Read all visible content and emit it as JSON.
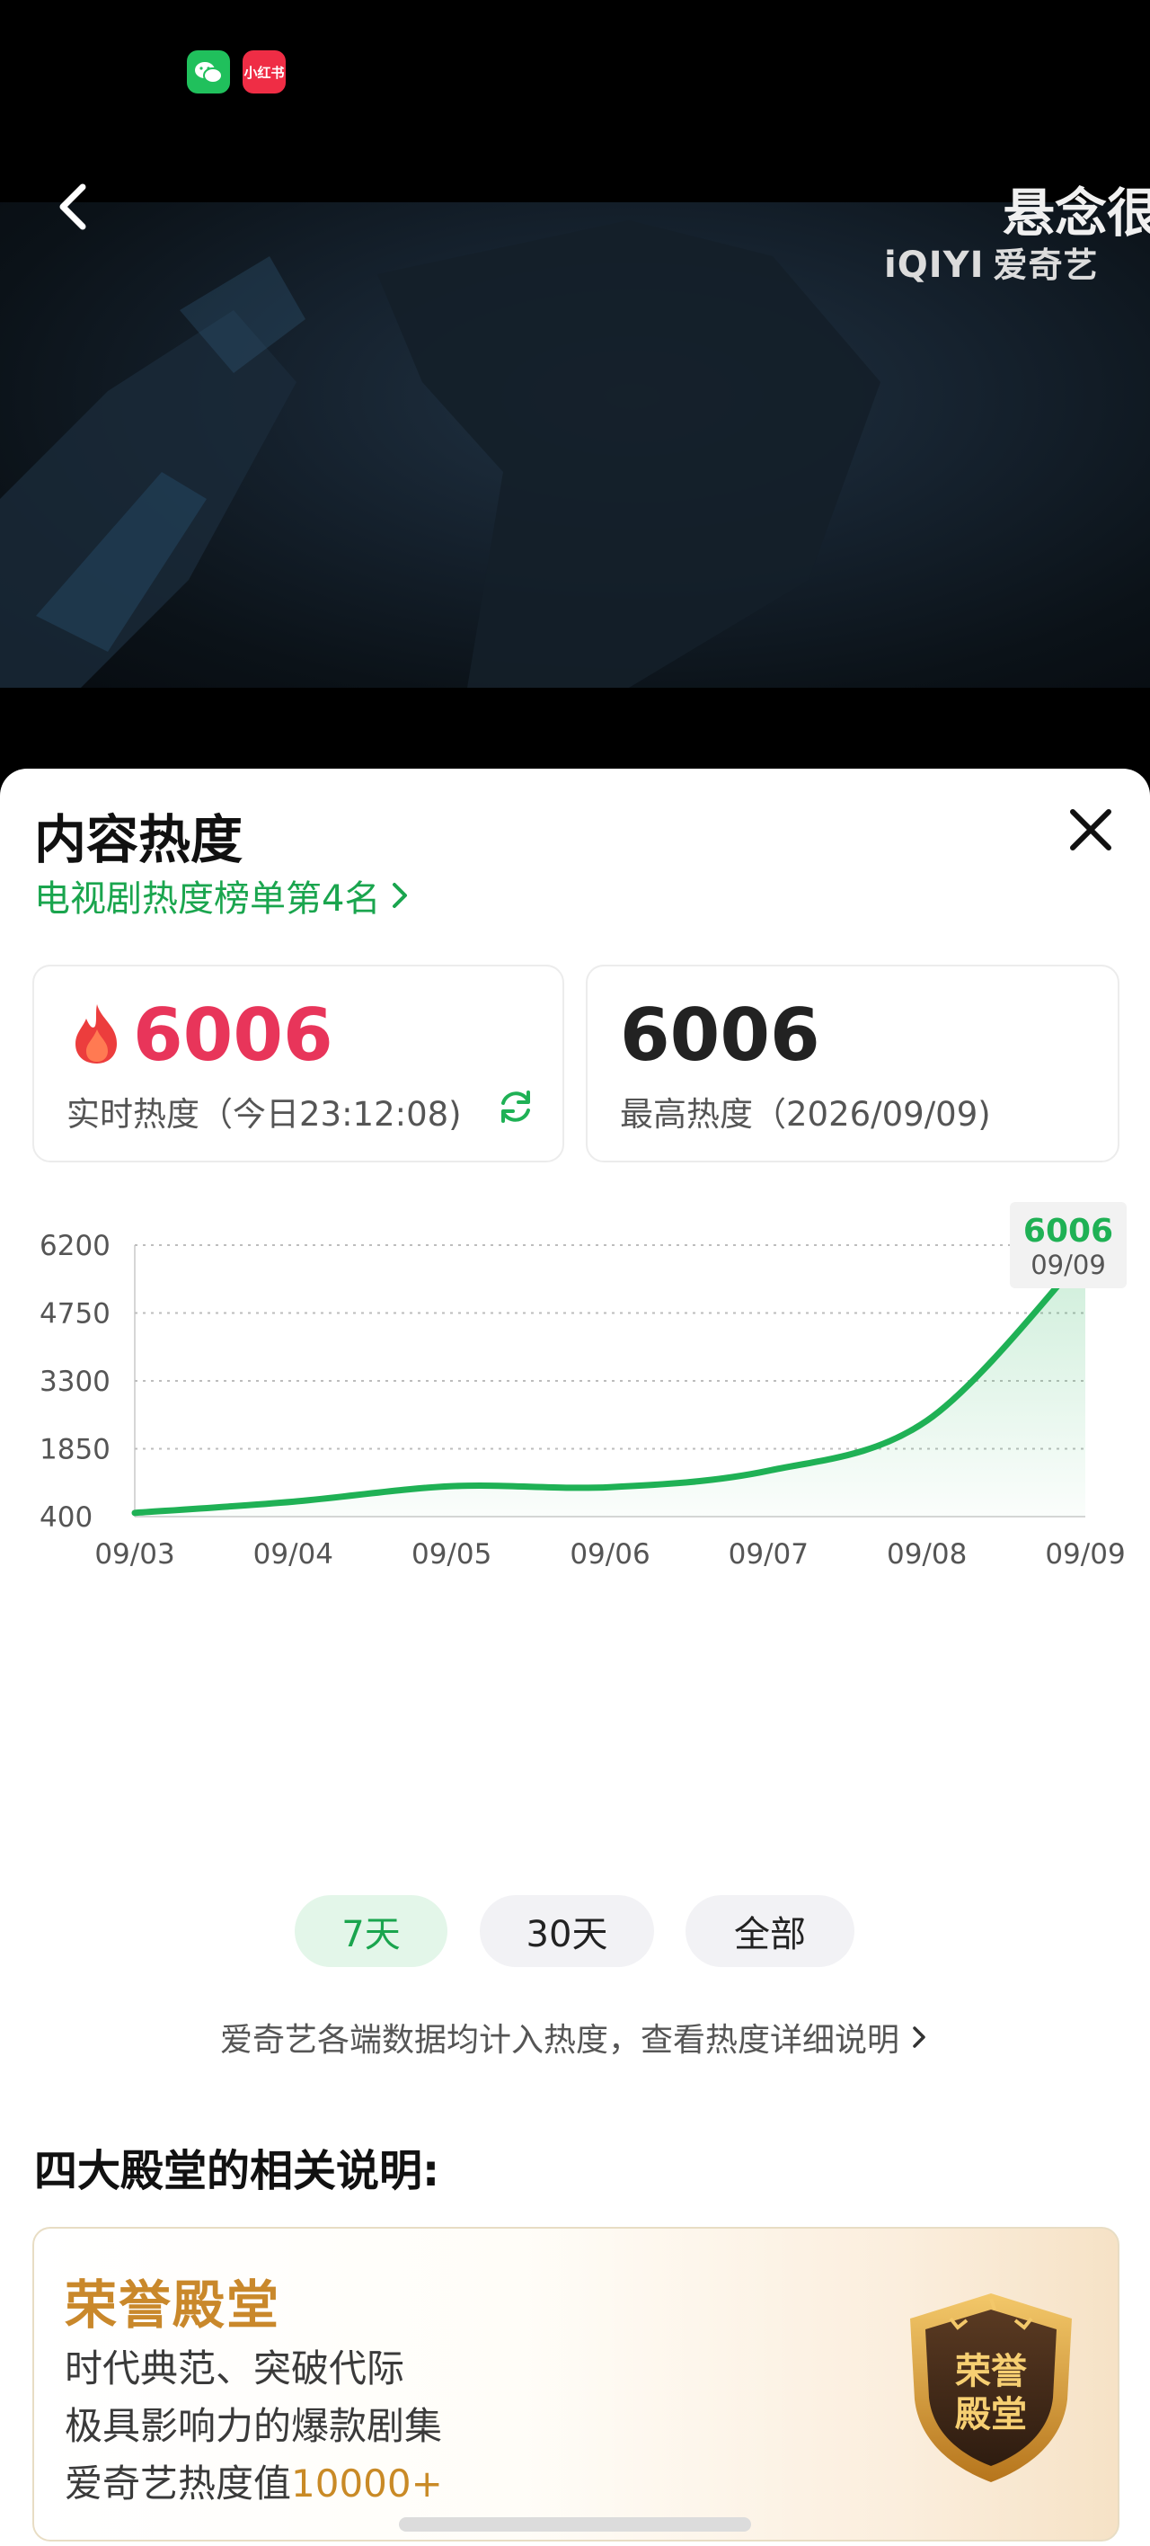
{
  "status_bar": {
    "apps": [
      {
        "name": "wechat-icon",
        "color": "#20c05c"
      },
      {
        "name": "xiaohongshu-icon",
        "label": "小红书",
        "color": "#ef2d45"
      }
    ]
  },
  "video": {
    "title": "悬念很",
    "watermark_en": "iQIYI",
    "watermark_cn": "爱奇艺"
  },
  "sheet": {
    "title": "内容热度",
    "rank_link": "电视剧热度榜单第4名"
  },
  "cards": {
    "realtime": {
      "value": "6006",
      "label": "实时热度（今日23:12:08)"
    },
    "peak": {
      "value": "6006",
      "label": "最高热度（2026/09/09)"
    }
  },
  "chart_data": {
    "type": "area",
    "x": [
      "09/03",
      "09/04",
      "09/05",
      "09/06",
      "09/07",
      "09/08",
      "09/09"
    ],
    "series": [
      {
        "values": [
          480,
          720,
          1050,
          1030,
          1380,
          2450,
          6006
        ]
      }
    ],
    "yticks": [
      400,
      1850,
      3300,
      4750,
      6200
    ],
    "ylim": [
      400,
      6200
    ],
    "grid": true,
    "tooltip": {
      "value": "6006",
      "label": "09/09"
    },
    "colors": {
      "line": "#1fb155",
      "fill": "#1fb155",
      "grid": "#bdbdbd"
    }
  },
  "tabs": [
    {
      "label": "7天",
      "selected": true
    },
    {
      "label": "30天",
      "selected": false
    },
    {
      "label": "全部",
      "selected": false
    }
  ],
  "note_link": "爱奇艺各端数据均计入热度，查看热度详细说明",
  "halls": {
    "heading": "四大殿堂的相关说明:",
    "card": {
      "title": "荣誉殿堂",
      "line1": "时代典范、突破代际",
      "line2": "极具影响力的爆款剧集",
      "line3_prefix": "爱奇艺热度值",
      "line3_value": "10000+",
      "badge_text": "荣誉殿堂"
    }
  }
}
